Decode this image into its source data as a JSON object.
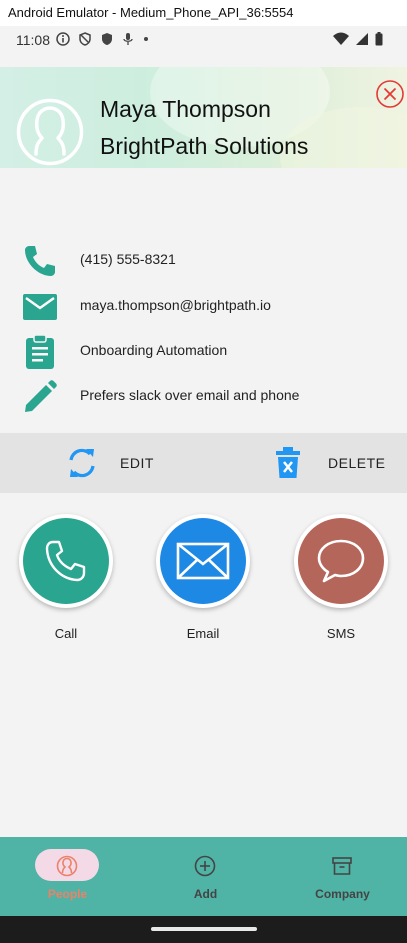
{
  "window": {
    "title": "Android Emulator - Medium_Phone_API_36:5554"
  },
  "status_bar": {
    "time": "11:08"
  },
  "contact": {
    "name": "Maya Thompson",
    "company": "BrightPath Solutions",
    "phone": "(415) 555-8321",
    "email": "maya.thompson@brightpath.io",
    "role": "Onboarding Automation",
    "note": "Prefers slack over email and phone"
  },
  "actions": {
    "edit": "EDIT",
    "delete": "DELETE"
  },
  "quick_actions": {
    "call": "Call",
    "email": "Email",
    "sms": "SMS"
  },
  "colors": {
    "teal": "#2aa590",
    "blue": "#1e88e5",
    "brick": "#b5665a",
    "navbar": "#4fb3a6",
    "accent": "#e9836a",
    "close": "#e53935"
  },
  "nav": {
    "people": "People",
    "add": "Add",
    "company": "Company",
    "active": "People"
  }
}
